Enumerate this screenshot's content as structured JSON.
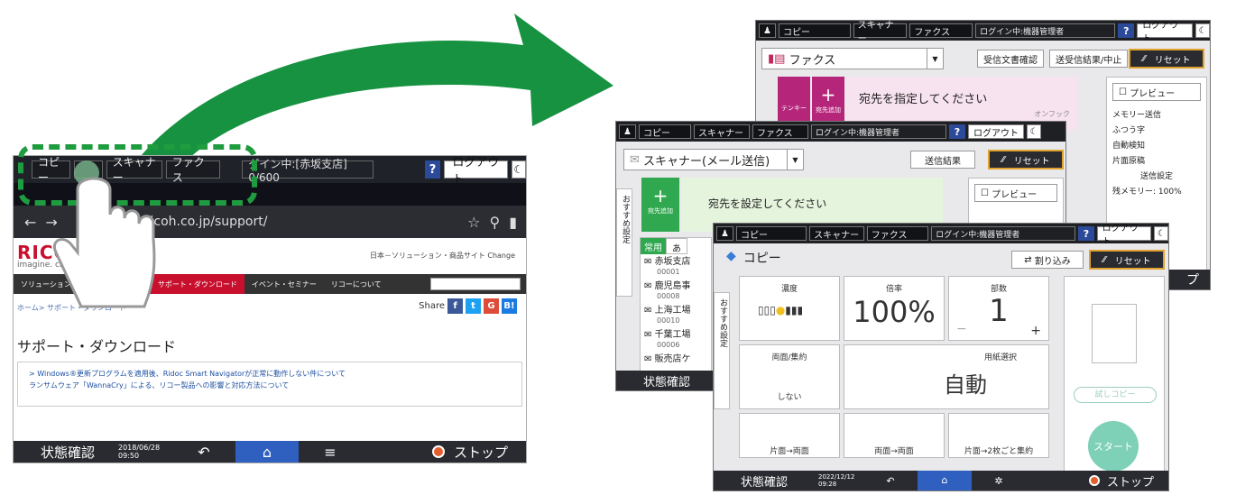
{
  "tablet": {
    "tabs": [
      "コピー",
      "スキャナー",
      "ファクス"
    ],
    "login": "グイン中:[赤坂支店] 0/600",
    "help": "?",
    "logout": "ログアウト",
    "url": "//www.ricoh.co.jp/support/",
    "logo": "RICO",
    "tagline": "imagine. ch",
    "sitelinks": "日本－ソリューション・商品サイト  Change",
    "nav": [
      "ソリューション",
      "サポート・ダウンロード",
      "イベント・セミナー",
      "リコーについて"
    ],
    "breadcrumb": "ホーム> サポート・ダウンロード",
    "share": "Share",
    "heading": "サポート・ダウンロード",
    "notice1": "> Windows®更新プログラムを適用後、Ridoc Smart Navigatorが正常に動作しない件について",
    "notice2": "ランサムウェア「WannaCry」による、リコー製品への影響と対応方法について",
    "status": "状態確認",
    "date": "2018/06/28",
    "time": "09:50",
    "stop": "ストップ"
  },
  "fax": {
    "tabs": [
      "コピー",
      "スキャナー",
      "ファクス"
    ],
    "login": "ログイン中:機器管理者",
    "logout": "ログアウト",
    "app": "ファクス",
    "btn_receive": "受信文書確認",
    "btn_result": "送受信結果/中止",
    "reset": "リセット",
    "tenkey": "テンキー",
    "add": "宛先追加",
    "dest_prompt": "宛先を指定してください",
    "onhook": "オンフック",
    "preview": "プレビュー",
    "options": [
      "メモリー送信",
      "ふつう字",
      "自動検知",
      "片面原稿",
      "送信設定"
    ],
    "memory": "残メモリー:  100%",
    "stop": "プ"
  },
  "scanner": {
    "tabs": [
      "コピー",
      "スキャナー",
      "ファクス"
    ],
    "login": "ログイン中:機器管理者",
    "logout": "ログアウト",
    "app": "スキャナー(メール送信)",
    "btn_result": "送信結果",
    "reset": "リセット",
    "add": "宛先追加",
    "dest_prompt": "宛先を設定してください",
    "side": "おすすめ設定",
    "preview": "プレビュー",
    "tab_common": "常用",
    "tab_a": "あ",
    "list": [
      {
        "name": "赤坂支店",
        "no": "00001"
      },
      {
        "name": "鹿児島事",
        "no": "00008"
      },
      {
        "name": "上海工場",
        "no": "00010"
      },
      {
        "name": "千葉工場",
        "no": "00006"
      },
      {
        "name": "販売店ケ",
        "no": ""
      }
    ],
    "status": "状態確認"
  },
  "copy": {
    "tabs": [
      "コピー",
      "スキャナー",
      "ファクス"
    ],
    "login": "ログイン中:機器管理者",
    "logout": "ログアウト",
    "app": "コピー",
    "interrupt": "割り込み",
    "reset": "リセット",
    "side": "おすすめ設定",
    "density": "濃度",
    "ratio_label": "倍率",
    "ratio": "100%",
    "copies_label": "部数",
    "copies": "1",
    "duplex_label": "両面/集約",
    "duplex_val": "しない",
    "paper_label": "用紙選択",
    "paper_val": "自動",
    "shortcut1": "片面→両面",
    "shortcut2": "両面→両面",
    "shortcut3": "片面→2枚ごと集約",
    "trial": "試しコピー",
    "start": "スタート",
    "status": "状態確認",
    "date": "2022/12/12",
    "time": "09:28",
    "stop": "ストップ"
  }
}
